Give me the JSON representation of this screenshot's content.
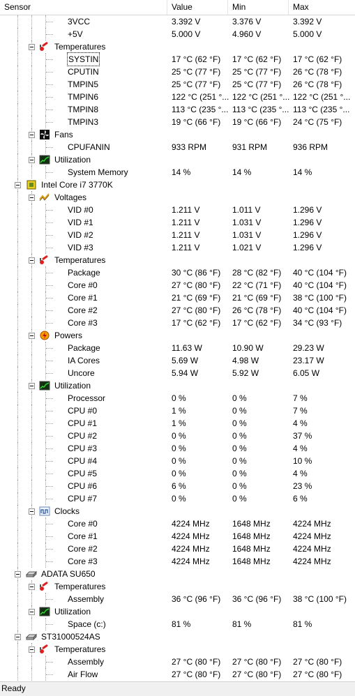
{
  "columns": [
    "Sensor",
    "Value",
    "Min",
    "Max"
  ],
  "rows": [
    {
      "lvl": 3,
      "name": "3VCC",
      "value": "3.392 V",
      "min": "3.376 V",
      "max": "3.392 V"
    },
    {
      "lvl": 3,
      "name": "+5V",
      "value": "5.000 V",
      "min": "4.960 V",
      "max": "5.000 V"
    },
    {
      "lvl": 2,
      "name": "Temperatures",
      "icon": "thermometer-icon"
    },
    {
      "lvl": 3,
      "name": "SYSTIN",
      "value": "17 °C  (62 °F)",
      "min": "17 °C  (62 °F)",
      "max": "17 °C  (62 °F)",
      "selected": true
    },
    {
      "lvl": 3,
      "name": "CPUTIN",
      "value": "25 °C  (77 °F)",
      "min": "25 °C  (77 °F)",
      "max": "26 °C  (78 °F)"
    },
    {
      "lvl": 3,
      "name": "TMPIN5",
      "value": "25 °C  (77 °F)",
      "min": "25 °C  (77 °F)",
      "max": "26 °C  (78 °F)"
    },
    {
      "lvl": 3,
      "name": "TMPIN6",
      "value": "122 °C  (251 °...",
      "min": "122 °C  (251 °...",
      "max": "122 °C  (251 °..."
    },
    {
      "lvl": 3,
      "name": "TMPIN8",
      "value": "113 °C  (235 °...",
      "min": "113 °C  (235 °...",
      "max": "113 °C  (235 °..."
    },
    {
      "lvl": 3,
      "name": "TMPIN3",
      "value": "19 °C  (66 °F)",
      "min": "19 °C  (66 °F)",
      "max": "24 °C  (75 °F)"
    },
    {
      "lvl": 2,
      "name": "Fans",
      "icon": "fan-icon"
    },
    {
      "lvl": 3,
      "name": "CPUFANIN",
      "value": "933 RPM",
      "min": "931 RPM",
      "max": "936 RPM"
    },
    {
      "lvl": 2,
      "name": "Utilization",
      "icon": "utilization-icon"
    },
    {
      "lvl": 3,
      "name": "System Memory",
      "value": "14 %",
      "min": "14 %",
      "max": "14 %"
    },
    {
      "lvl": 1,
      "name": "Intel Core i7 3770K",
      "icon": "cpu-chip-icon"
    },
    {
      "lvl": 2,
      "name": "Voltages",
      "icon": "voltage-icon"
    },
    {
      "lvl": 3,
      "name": "VID #0",
      "value": "1.211 V",
      "min": "1.011 V",
      "max": "1.296 V"
    },
    {
      "lvl": 3,
      "name": "VID #1",
      "value": "1.211 V",
      "min": "1.031 V",
      "max": "1.296 V"
    },
    {
      "lvl": 3,
      "name": "VID #2",
      "value": "1.211 V",
      "min": "1.031 V",
      "max": "1.296 V"
    },
    {
      "lvl": 3,
      "name": "VID #3",
      "value": "1.211 V",
      "min": "1.021 V",
      "max": "1.296 V"
    },
    {
      "lvl": 2,
      "name": "Temperatures",
      "icon": "thermometer-icon"
    },
    {
      "lvl": 3,
      "name": "Package",
      "value": "30 °C  (86 °F)",
      "min": "28 °C  (82 °F)",
      "max": "40 °C  (104 °F)"
    },
    {
      "lvl": 3,
      "name": "Core #0",
      "value": "27 °C  (80 °F)",
      "min": "22 °C  (71 °F)",
      "max": "40 °C  (104 °F)"
    },
    {
      "lvl": 3,
      "name": "Core #1",
      "value": "21 °C  (69 °F)",
      "min": "21 °C  (69 °F)",
      "max": "38 °C  (100 °F)"
    },
    {
      "lvl": 3,
      "name": "Core #2",
      "value": "27 °C  (80 °F)",
      "min": "26 °C  (78 °F)",
      "max": "40 °C  (104 °F)"
    },
    {
      "lvl": 3,
      "name": "Core #3",
      "value": "17 °C  (62 °F)",
      "min": "17 °C  (62 °F)",
      "max": "34 °C  (93 °F)"
    },
    {
      "lvl": 2,
      "name": "Powers",
      "icon": "power-icon"
    },
    {
      "lvl": 3,
      "name": "Package",
      "value": "11.63 W",
      "min": "10.90 W",
      "max": "29.23 W"
    },
    {
      "lvl": 3,
      "name": "IA Cores",
      "value": "5.69 W",
      "min": "4.98 W",
      "max": "23.17 W"
    },
    {
      "lvl": 3,
      "name": "Uncore",
      "value": "5.94 W",
      "min": "5.92 W",
      "max": "6.05 W"
    },
    {
      "lvl": 2,
      "name": "Utilization",
      "icon": "utilization-icon"
    },
    {
      "lvl": 3,
      "name": "Processor",
      "value": "0 %",
      "min": "0 %",
      "max": "7 %"
    },
    {
      "lvl": 3,
      "name": "CPU #0",
      "value": "1 %",
      "min": "0 %",
      "max": "7 %"
    },
    {
      "lvl": 3,
      "name": "CPU #1",
      "value": "1 %",
      "min": "0 %",
      "max": "4 %"
    },
    {
      "lvl": 3,
      "name": "CPU #2",
      "value": "0 %",
      "min": "0 %",
      "max": "37 %"
    },
    {
      "lvl": 3,
      "name": "CPU #3",
      "value": "0 %",
      "min": "0 %",
      "max": "4 %"
    },
    {
      "lvl": 3,
      "name": "CPU #4",
      "value": "0 %",
      "min": "0 %",
      "max": "10 %"
    },
    {
      "lvl": 3,
      "name": "CPU #5",
      "value": "0 %",
      "min": "0 %",
      "max": "4 %"
    },
    {
      "lvl": 3,
      "name": "CPU #6",
      "value": "6 %",
      "min": "0 %",
      "max": "23 %"
    },
    {
      "lvl": 3,
      "name": "CPU #7",
      "value": "0 %",
      "min": "0 %",
      "max": "6 %"
    },
    {
      "lvl": 2,
      "name": "Clocks",
      "icon": "clock-icon"
    },
    {
      "lvl": 3,
      "name": "Core #0",
      "value": "4224 MHz",
      "min": "1648 MHz",
      "max": "4224 MHz"
    },
    {
      "lvl": 3,
      "name": "Core #1",
      "value": "4224 MHz",
      "min": "1648 MHz",
      "max": "4224 MHz"
    },
    {
      "lvl": 3,
      "name": "Core #2",
      "value": "4224 MHz",
      "min": "1648 MHz",
      "max": "4224 MHz"
    },
    {
      "lvl": 3,
      "name": "Core #3",
      "value": "4224 MHz",
      "min": "1648 MHz",
      "max": "4224 MHz"
    },
    {
      "lvl": 1,
      "name": "ADATA SU650",
      "icon": "disk-drive-icon"
    },
    {
      "lvl": 2,
      "name": "Temperatures",
      "icon": "thermometer-icon"
    },
    {
      "lvl": 3,
      "name": "Assembly",
      "value": "36 °C  (96 °F)",
      "min": "36 °C  (96 °F)",
      "max": "38 °C  (100 °F)"
    },
    {
      "lvl": 2,
      "name": "Utilization",
      "icon": "utilization-icon"
    },
    {
      "lvl": 3,
      "name": "Space (c:)",
      "value": "81 %",
      "min": "81 %",
      "max": "81 %"
    },
    {
      "lvl": 1,
      "name": "ST31000524AS",
      "icon": "disk-drive-icon"
    },
    {
      "lvl": 2,
      "name": "Temperatures",
      "icon": "thermometer-icon"
    },
    {
      "lvl": 3,
      "name": "Assembly",
      "value": "27 °C  (80 °F)",
      "min": "27 °C  (80 °F)",
      "max": "27 °C  (80 °F)"
    },
    {
      "lvl": 3,
      "name": "Air Flow",
      "value": "27 °C  (80 °F)",
      "min": "27 °C  (80 °F)",
      "max": "27 °C  (80 °F)"
    }
  ],
  "status": {
    "text": "Ready"
  }
}
